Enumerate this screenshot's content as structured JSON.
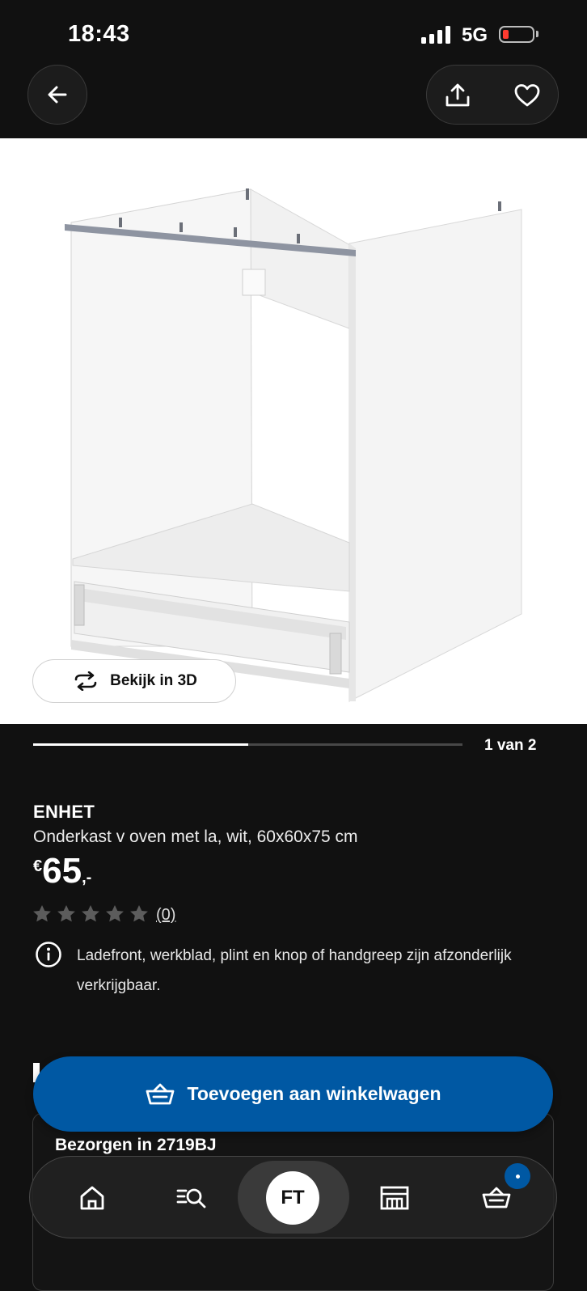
{
  "status_bar": {
    "time": "18:43",
    "network": "5G"
  },
  "gallery": {
    "view_3d_label": "Bekijk in 3D",
    "pager_label": "1 van 2",
    "progress": 0.5
  },
  "product": {
    "brand": "ENHET",
    "description": "Onderkast v oven met la, wit, 60x60x75 cm",
    "price_currency": "€",
    "price_amount": "65",
    "price_suffix": ",-",
    "rating_stars": 0,
    "rating_count": "(0)",
    "info_text": "Ladefront, werkblad, plint en knop of handgreep zijn afzonderlijk verkrijgbaar."
  },
  "delivery": {
    "title": "Bezorgen in 2719BJ"
  },
  "cta": {
    "add_to_cart_label": "Toevoegen aan winkelwagen"
  },
  "bottom_nav": {
    "profile_initials": "FT"
  },
  "colors": {
    "accent": "#0058a3",
    "background": "#111111",
    "battery_low": "#ff3b30"
  },
  "icons": [
    "back-arrow-icon",
    "share-icon",
    "heart-icon",
    "rotate-3d-icon",
    "info-icon",
    "basket-icon",
    "home-icon",
    "search-list-icon",
    "store-icon",
    "cart-icon",
    "star-icon"
  ]
}
